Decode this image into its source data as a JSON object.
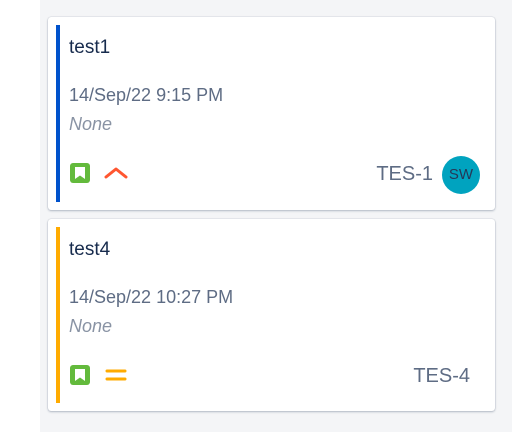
{
  "cards": [
    {
      "title": "test1",
      "date": "14/Sep/22 9:15 PM",
      "subtitle": "None",
      "issue_key": "TES-1",
      "issue_type_icon": "story-icon",
      "priority": "High",
      "priority_icon": "chevron-up-icon",
      "accent_color": "#0052cc",
      "avatar": {
        "initials": "SW",
        "color": "#00a3bf"
      }
    },
    {
      "title": "test4",
      "date": "14/Sep/22 10:27 PM",
      "subtitle": "None",
      "issue_key": "TES-4",
      "issue_type_icon": "story-icon",
      "priority": "Medium",
      "priority_icon": "equals-icon",
      "accent_color": "#ffab00"
    }
  ],
  "colors": {
    "story_green": "#63ba3c",
    "priority_high": "#ff5630",
    "priority_medium": "#ffab00",
    "column_bg": "#f4f5f7"
  }
}
